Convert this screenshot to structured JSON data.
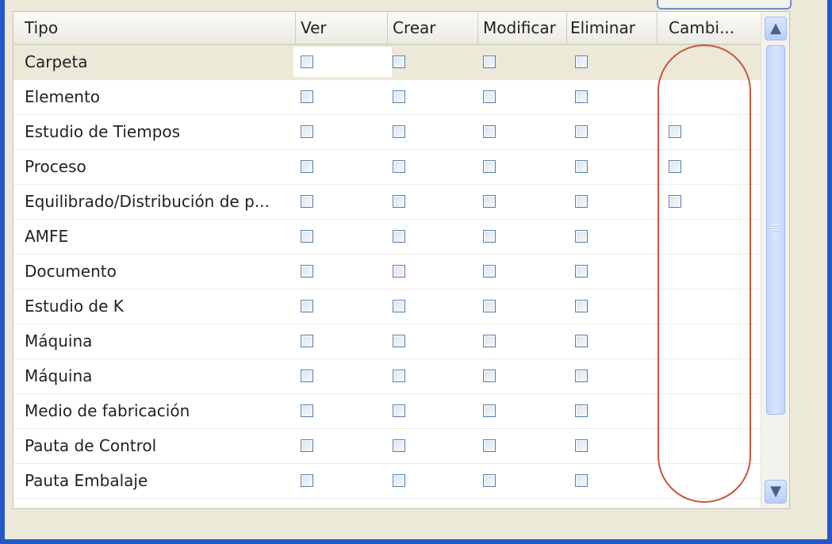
{
  "window": {
    "title": ""
  },
  "table": {
    "columns": [
      "Tipo",
      "Ver",
      "Crear",
      "Modificar",
      "Eliminar",
      "Cambi..."
    ],
    "rows": [
      {
        "type": "Carpeta",
        "ver": false,
        "crear": false,
        "modificar": false,
        "eliminar": false,
        "cambiar": null,
        "selected": true
      },
      {
        "type": "Elemento",
        "ver": false,
        "crear": false,
        "modificar": false,
        "eliminar": false,
        "cambiar": null
      },
      {
        "type": "Estudio de Tiempos",
        "ver": false,
        "crear": false,
        "modificar": false,
        "eliminar": false,
        "cambiar": false
      },
      {
        "type": "Proceso",
        "ver": false,
        "crear": false,
        "modificar": false,
        "eliminar": false,
        "cambiar": false
      },
      {
        "type": "Equilibrado/Distribución de p...",
        "ver": false,
        "crear": false,
        "modificar": false,
        "eliminar": false,
        "cambiar": false
      },
      {
        "type": "AMFE",
        "ver": false,
        "crear": false,
        "modificar": false,
        "eliminar": false,
        "cambiar": null
      },
      {
        "type": "Documento",
        "ver": false,
        "crear": false,
        "modificar": false,
        "eliminar": false,
        "cambiar": null
      },
      {
        "type": "Estudio de K",
        "ver": false,
        "crear": false,
        "modificar": false,
        "eliminar": false,
        "cambiar": null
      },
      {
        "type": "Máquina",
        "ver": false,
        "crear": false,
        "modificar": false,
        "eliminar": false,
        "cambiar": null
      },
      {
        "type": "Máquina",
        "ver": false,
        "crear": false,
        "modificar": false,
        "eliminar": false,
        "cambiar": null
      },
      {
        "type": "Medio de fabricación",
        "ver": false,
        "crear": false,
        "modificar": false,
        "eliminar": false,
        "cambiar": null
      },
      {
        "type": "Pauta de Control",
        "ver": false,
        "crear": false,
        "modificar": false,
        "eliminar": false,
        "cambiar": null
      },
      {
        "type": "Pauta Embalaje",
        "ver": false,
        "crear": false,
        "modificar": false,
        "eliminar": false,
        "cambiar": null
      },
      {
        "type": "",
        "ver": false,
        "crear": false,
        "modificar": false,
        "eliminar": false,
        "cambiar": null
      }
    ]
  },
  "scrollbar": {
    "up_icon": "chevron-up-icon",
    "down_icon": "chevron-down-icon"
  },
  "annotation": {
    "color": "#c8553d"
  },
  "colors": {
    "frame": "#2458c8",
    "selected_row": "#ece9d8"
  }
}
